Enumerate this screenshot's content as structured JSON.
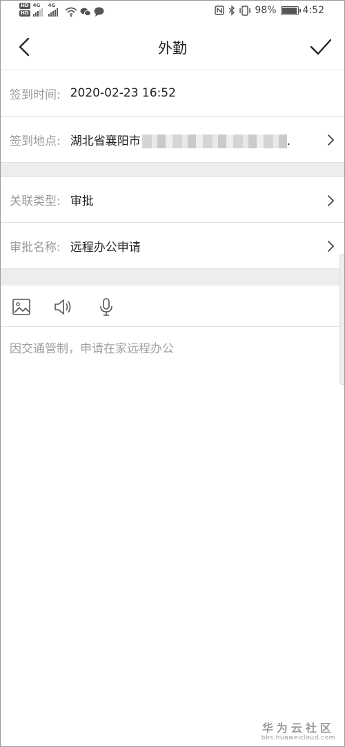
{
  "status_bar": {
    "left_badges": [
      "HD",
      "HD"
    ],
    "network_tags": [
      "4G",
      "4G"
    ],
    "left_icons": [
      "wifi-icon",
      "wechat-icon",
      "message-icon"
    ],
    "right_icons": [
      "nfc-icon",
      "bluetooth-icon",
      "vibrate-icon"
    ],
    "battery_percent": "98%",
    "battery_level": 0.98,
    "time": "4:52"
  },
  "header": {
    "title": "外勤",
    "back_icon": "chevron-left-icon",
    "confirm_icon": "checkmark-icon"
  },
  "form": {
    "checkin_time": {
      "label": "签到时间:",
      "value": "2020-02-23 16:52"
    },
    "checkin_location": {
      "label": "签到地点:",
      "value": "湖北省襄阳市",
      "tail": "."
    },
    "relation_type": {
      "label": "关联类型:",
      "value": "审批"
    },
    "approval_name": {
      "label": "审批名称:",
      "value": "远程办公申请"
    }
  },
  "toolbar": {
    "items": [
      "image-icon",
      "speaker-icon",
      "microphone-icon"
    ]
  },
  "note": {
    "text": "因交通管制，申请在家远程办公"
  },
  "watermark": {
    "main": "华为云社区",
    "sub": "bbs.huaweicloud.com"
  },
  "colors": {
    "label_gray": "#9a9a9a",
    "divider": "#e2e2e2",
    "section_gap": "#ededed",
    "text": "#222222"
  }
}
